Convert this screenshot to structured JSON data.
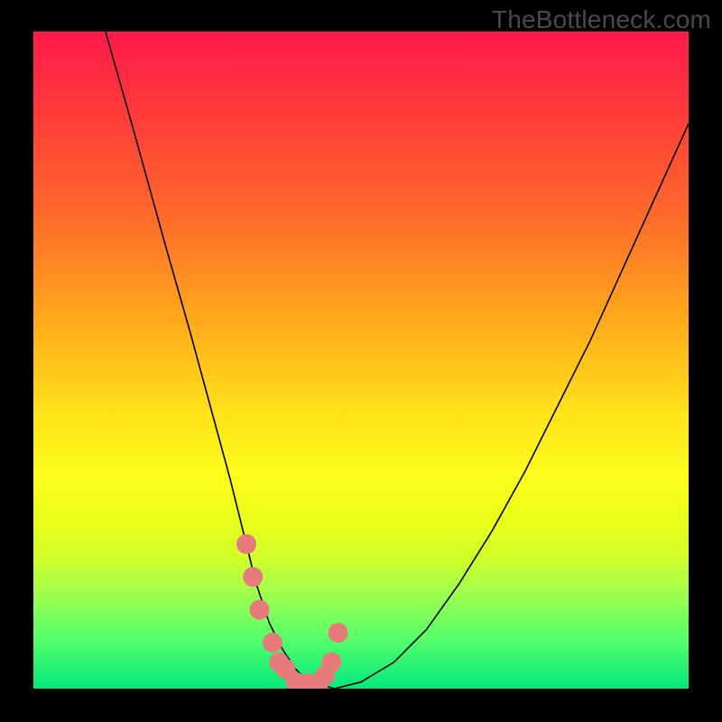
{
  "watermark": "TheBottleneck.com",
  "chart_data": {
    "type": "line",
    "title": "",
    "xlabel": "",
    "ylabel": "",
    "xlim": [
      0,
      100
    ],
    "ylim": [
      0,
      100
    ],
    "series": [
      {
        "name": "curve",
        "x": [
          11,
          15,
          20,
          24,
          27,
          30,
          32,
          34,
          36,
          38,
          40,
          42,
          46,
          50,
          55,
          60,
          65,
          70,
          75,
          80,
          85,
          90,
          95,
          100
        ],
        "values": [
          100,
          86,
          68,
          54,
          43,
          32,
          24,
          16,
          10,
          6,
          3,
          1,
          0,
          1,
          4,
          9,
          16,
          24,
          33,
          43,
          53,
          64,
          75,
          86
        ]
      }
    ],
    "markers": {
      "name": "highlight",
      "color": "#e77a7a",
      "x": [
        32.5,
        33.5,
        34.5,
        36.5,
        37.5,
        38.5,
        40,
        42,
        43.5,
        44.5,
        45.5,
        46.5
      ],
      "values": [
        22,
        17,
        12,
        7,
        4,
        3,
        1,
        0.8,
        0.8,
        2,
        4,
        8.5
      ]
    },
    "curve_color": "#000000",
    "curve_width": 1.6
  }
}
